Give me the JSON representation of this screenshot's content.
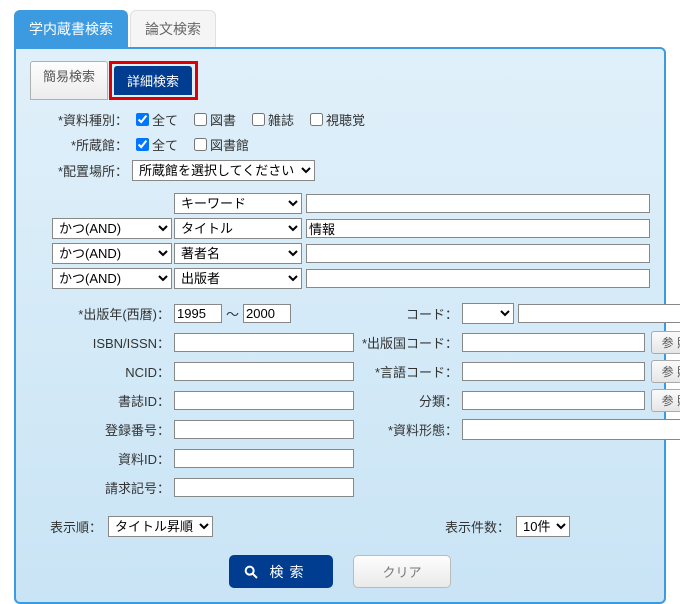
{
  "topTabs": {
    "library": "学内蔵書検索",
    "thesis": "論文検索"
  },
  "subTabs": {
    "simple": "簡易検索",
    "detail": "詳細検索"
  },
  "materialType": {
    "label": "*資料種別：",
    "all": "全て",
    "books": "図書",
    "serials": "雑誌",
    "av": "視聴覚"
  },
  "holding": {
    "label": "*所蔵館：",
    "all": "全て",
    "library": "図書館"
  },
  "location": {
    "label": "*配置場所：",
    "option": "所蔵館を選択してください"
  },
  "searchRows": {
    "ops": [
      "かつ(AND)",
      "かつ(AND)",
      "かつ(AND)"
    ],
    "fields": [
      "キーワード",
      "タイトル",
      "著者名",
      "出版者"
    ],
    "values": [
      "",
      "情報",
      "",
      ""
    ]
  },
  "left": {
    "pubYear": "*出版年(西暦)：",
    "yearFrom": "1995",
    "yearTo": "2000",
    "isbn": "ISBN/ISSN：",
    "ncid": "NCID：",
    "biblioId": "書誌ID：",
    "regNo": "登録番号：",
    "matId": "資料ID：",
    "callNo": "請求記号："
  },
  "right": {
    "code": "コード：",
    "pubCountry": "*出版国コード：",
    "langCode": "*言語コード：",
    "class": "分類：",
    "matForm": "*資料形態：",
    "ref": "参 照"
  },
  "sort": {
    "orderLabel": "表示順：",
    "orderValue": "タイトル昇順",
    "countLabel": "表示件数：",
    "countValue": "10件"
  },
  "actions": {
    "search": "検索",
    "clear": "クリア"
  }
}
